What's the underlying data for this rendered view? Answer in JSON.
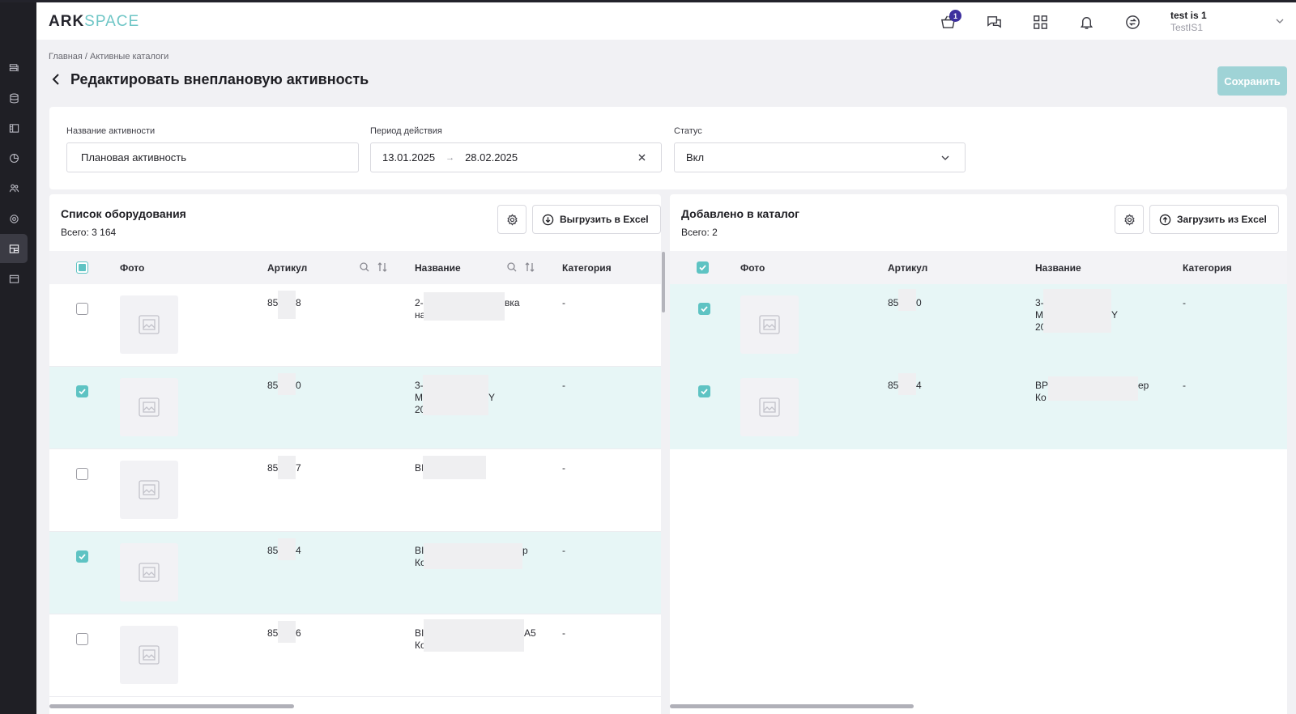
{
  "app": {
    "logo_main": "ARK",
    "logo_accent": "SPACE"
  },
  "header": {
    "cart_badge": "1",
    "user": {
      "name": "test is 1",
      "company": "TestIS1"
    }
  },
  "breadcrumb": "Главная / Активные каталоги",
  "page": {
    "title": "Редактировать внеплановую активность",
    "save_label": "Сохранить"
  },
  "form": {
    "name_label": "Название активности",
    "name_value": "Плановая активность",
    "period_label": "Период действия",
    "period_start": "13.01.2025",
    "period_end": "28.02.2025",
    "status_label": "Статус",
    "status_value": "Вкл"
  },
  "left_panel": {
    "title": "Список оборудования",
    "count": "Всего: 3 164",
    "export_label": "Выгрузить в Excel",
    "columns": {
      "photo": "Фото",
      "article": "Артикул",
      "name": "Название",
      "category": "Категория"
    },
    "rows": [
      {
        "checked": false,
        "article_a": "85",
        "article_b": "8",
        "name_l1a": "2-",
        "name_l1b": "вка",
        "name_l2": "на",
        "category": "-"
      },
      {
        "checked": true,
        "article_a": "85",
        "article_b": "0",
        "name_l1a": "3-",
        "name_l1b": "",
        "name_l2": "M",
        "name_l2b": "Y",
        "name_l3": "20",
        "category": "-"
      },
      {
        "checked": false,
        "article_a": "85",
        "article_b": "7",
        "name_l1a": "BI",
        "name_l1b": "",
        "name_l2": "",
        "category": "-"
      },
      {
        "checked": true,
        "article_a": "85",
        "article_b": "4",
        "name_l1a": "BI",
        "name_l1b": "р",
        "name_l2": "Ко",
        "category": "-"
      },
      {
        "checked": false,
        "article_a": "85",
        "article_b": "6",
        "name_l1a": "BI",
        "name_l1b": "A5",
        "name_l2": "Ко",
        "category": "-"
      }
    ]
  },
  "right_panel": {
    "title": "Добавлено в каталог",
    "count": "Всего: 2",
    "import_label": "Загрузить из Excel",
    "columns": {
      "photo": "Фото",
      "article": "Артикул",
      "name": "Название",
      "category": "Категория"
    },
    "rows": [
      {
        "checked": true,
        "article_a": "85",
        "article_b": "0",
        "name_l1a": "3-",
        "name_l2": "M",
        "name_l2b": "Y",
        "name_l3": "20",
        "category": "-"
      },
      {
        "checked": true,
        "article_a": "85",
        "article_b": "4",
        "name_l1a": "BP",
        "name_l1b": "ер",
        "name_l2": "Ко",
        "category": "-"
      }
    ]
  }
}
